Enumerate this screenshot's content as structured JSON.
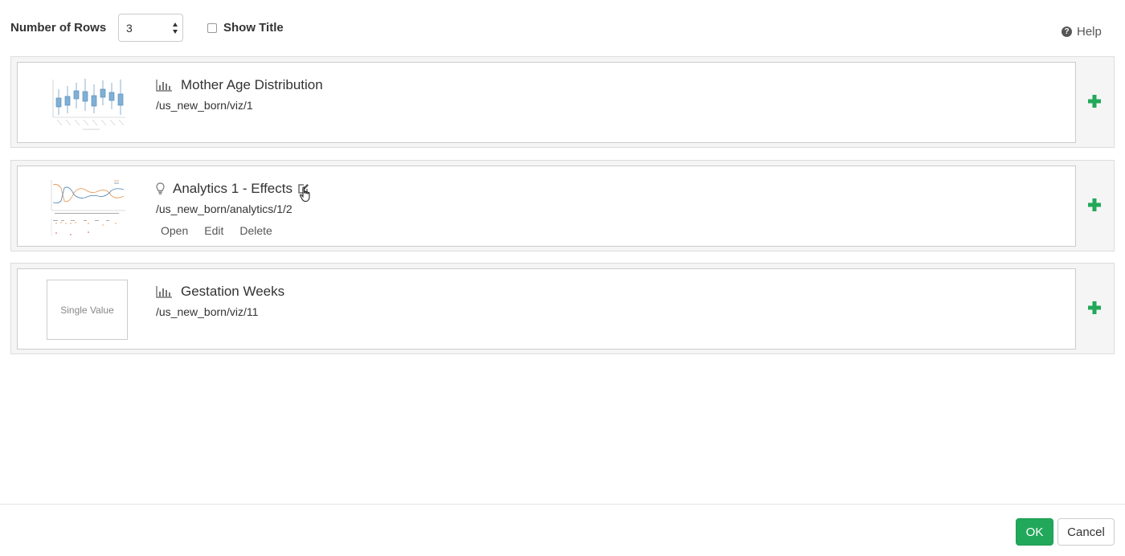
{
  "toolbar": {
    "rows_label": "Number of Rows",
    "rows_value": "3",
    "show_title_label": "Show Title",
    "show_title_checked": false,
    "help_label": "Help"
  },
  "rows": [
    {
      "title": "Mother Age Distribution",
      "path": "/us_new_born/viz/1",
      "icon": "bar-chart-icon",
      "thumbnail": "boxplot-thumbnail"
    },
    {
      "title": "Analytics 1 - Effects",
      "path": "/us_new_born/analytics/1/2",
      "icon": "lightbulb-icon",
      "thumbnail": "line-chart-thumbnail",
      "actions": [
        "Open",
        "Edit",
        "Delete"
      ]
    },
    {
      "title": "Gestation Weeks",
      "path": "/us_new_born/viz/11",
      "icon": "bar-chart-icon",
      "thumbnail_text": "Single Value"
    }
  ],
  "footer": {
    "ok_label": "OK",
    "cancel_label": "Cancel"
  },
  "colors": {
    "accent": "#22a85a",
    "plus": "#22a85a",
    "thumb_blue": "#7fb0d6"
  }
}
